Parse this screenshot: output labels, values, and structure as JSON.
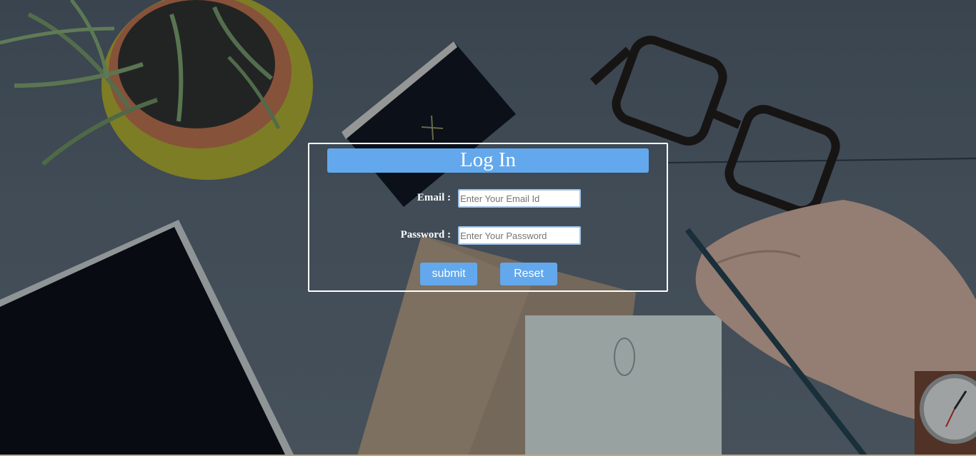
{
  "login": {
    "title": "Log In",
    "email": {
      "label": "Email :",
      "placeholder": "Enter Your Email Id",
      "value": ""
    },
    "password": {
      "label": "Password :",
      "placeholder": "Enter Your Password",
      "value": ""
    },
    "submit_label": "submit",
    "reset_label": "Reset"
  },
  "colors": {
    "accent": "#63a8ec",
    "panel_border": "#ffffff",
    "text_on_dark": "#ffffff"
  },
  "background": {
    "icons": [
      "plant-icon",
      "notebook-icon",
      "glasses-icon",
      "tablet-icon",
      "envelope-icon",
      "notepad-icon",
      "hand-with-pencil-icon",
      "wristwatch-icon"
    ]
  }
}
